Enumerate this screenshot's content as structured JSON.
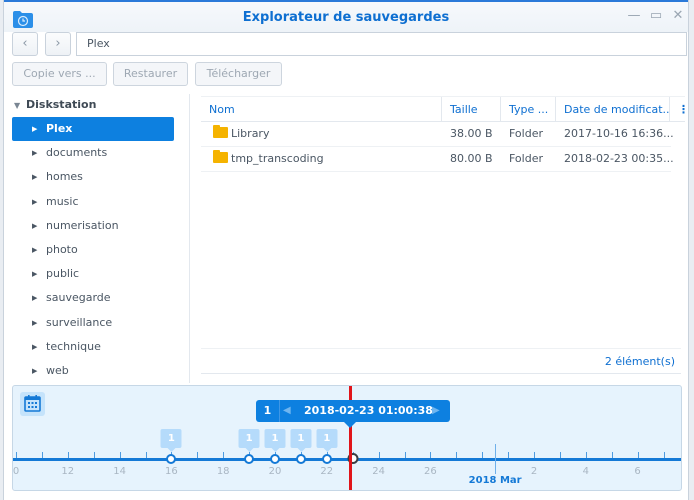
{
  "window": {
    "title": "Explorateur de sauvegardes",
    "app_icon": "backup-folder-clock-icon",
    "controls": {
      "minimize": "—",
      "maximize": "▭",
      "close": "✕"
    }
  },
  "nav": {
    "back": "‹",
    "forward": "›",
    "path": "Plex"
  },
  "toolbar": {
    "copy_label": "Copie vers ...",
    "restore_label": "Restaurer",
    "download_label": "Télécharger"
  },
  "tree": {
    "root": "Diskstation",
    "items": [
      {
        "label": "Plex",
        "selected": true
      },
      {
        "label": "documents"
      },
      {
        "label": "homes"
      },
      {
        "label": "music"
      },
      {
        "label": "numerisation"
      },
      {
        "label": "photo"
      },
      {
        "label": "public"
      },
      {
        "label": "sauvegarde"
      },
      {
        "label": "surveillance"
      },
      {
        "label": "technique"
      },
      {
        "label": "web"
      }
    ]
  },
  "files": {
    "columns": [
      "Nom",
      "Taille",
      "Type ...",
      "Date de modificat..."
    ],
    "more_icon": "⋮",
    "rows": [
      {
        "name": "Library",
        "size": "38.00 B",
        "type": "Folder",
        "date": "2017-10-16 16:36..."
      },
      {
        "name": "tmp_transcoding",
        "size": "80.00 B",
        "type": "Folder",
        "date": "2018-02-23 00:35..."
      }
    ],
    "count": "2 élément(s)"
  },
  "timeline": {
    "calendar_icon": "calendar-icon",
    "popup": {
      "count": "1",
      "date": "2018-02-23 01:00:38",
      "prev": "◀",
      "next": "▶"
    },
    "tick_labels": [
      "0",
      "12",
      "14",
      "16",
      "18",
      "20",
      "22",
      "24",
      "26",
      "2",
      "4",
      "6"
    ],
    "month_label": "2018 Mar",
    "snapshots": [
      {
        "day": 16,
        "count": "1"
      },
      {
        "day": 19,
        "count": "1"
      },
      {
        "day": 20,
        "count": "1"
      },
      {
        "day": 21,
        "count": "1"
      },
      {
        "day": 22,
        "count": "1"
      },
      {
        "day": 23,
        "count": "1",
        "current": true
      }
    ],
    "colors": {
      "accent": "#0d80e0",
      "cursor": "#e0141a"
    }
  }
}
